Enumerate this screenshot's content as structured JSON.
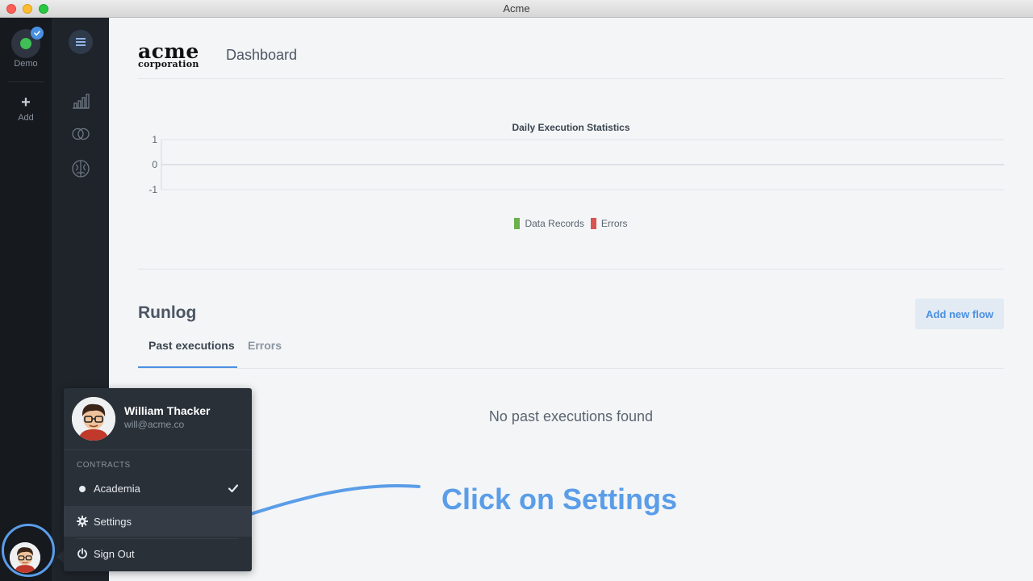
{
  "window": {
    "title": "Acme"
  },
  "workspaces": [
    {
      "label": "Demo",
      "status_color": "#3fbf56",
      "selected": true
    },
    {
      "label": "Add",
      "icon": "plus-icon"
    }
  ],
  "nav": {
    "menu_icon": "hamburger-icon",
    "items": [
      {
        "icon": "bar-chart-icon"
      },
      {
        "icon": "rings-icon"
      },
      {
        "icon": "brain-icon"
      }
    ]
  },
  "header": {
    "logo_line1": "acme",
    "logo_line2": "corporation",
    "title": "Dashboard"
  },
  "chart_data": {
    "type": "bar",
    "title": "Daily Execution Statistics",
    "categories": [],
    "series": [
      {
        "name": "Data Records",
        "color": "#6ab04c",
        "values": []
      },
      {
        "name": "Errors",
        "color": "#d9534f",
        "values": []
      }
    ],
    "ylim": [
      -1,
      1
    ],
    "yticks": [
      "1",
      "0",
      "-1"
    ],
    "legend_position": "bottom-center",
    "grid": false
  },
  "runlog": {
    "title": "Runlog",
    "add_button": "Add new flow",
    "tabs": [
      {
        "label": "Past executions",
        "active": true
      },
      {
        "label": "Errors",
        "active": false
      }
    ],
    "empty_message": "No past executions found"
  },
  "user_menu": {
    "name": "William Thacker",
    "email": "will@acme.co",
    "section_label": "CONTRACTS",
    "contracts": [
      {
        "label": "Academia",
        "checked": true
      }
    ],
    "actions": [
      {
        "label": "Settings",
        "icon": "gear-icon"
      },
      {
        "label": "Sign Out",
        "icon": "power-icon"
      }
    ]
  },
  "tutorial": {
    "text": "Click on Settings",
    "accent": "#5a9de8"
  }
}
